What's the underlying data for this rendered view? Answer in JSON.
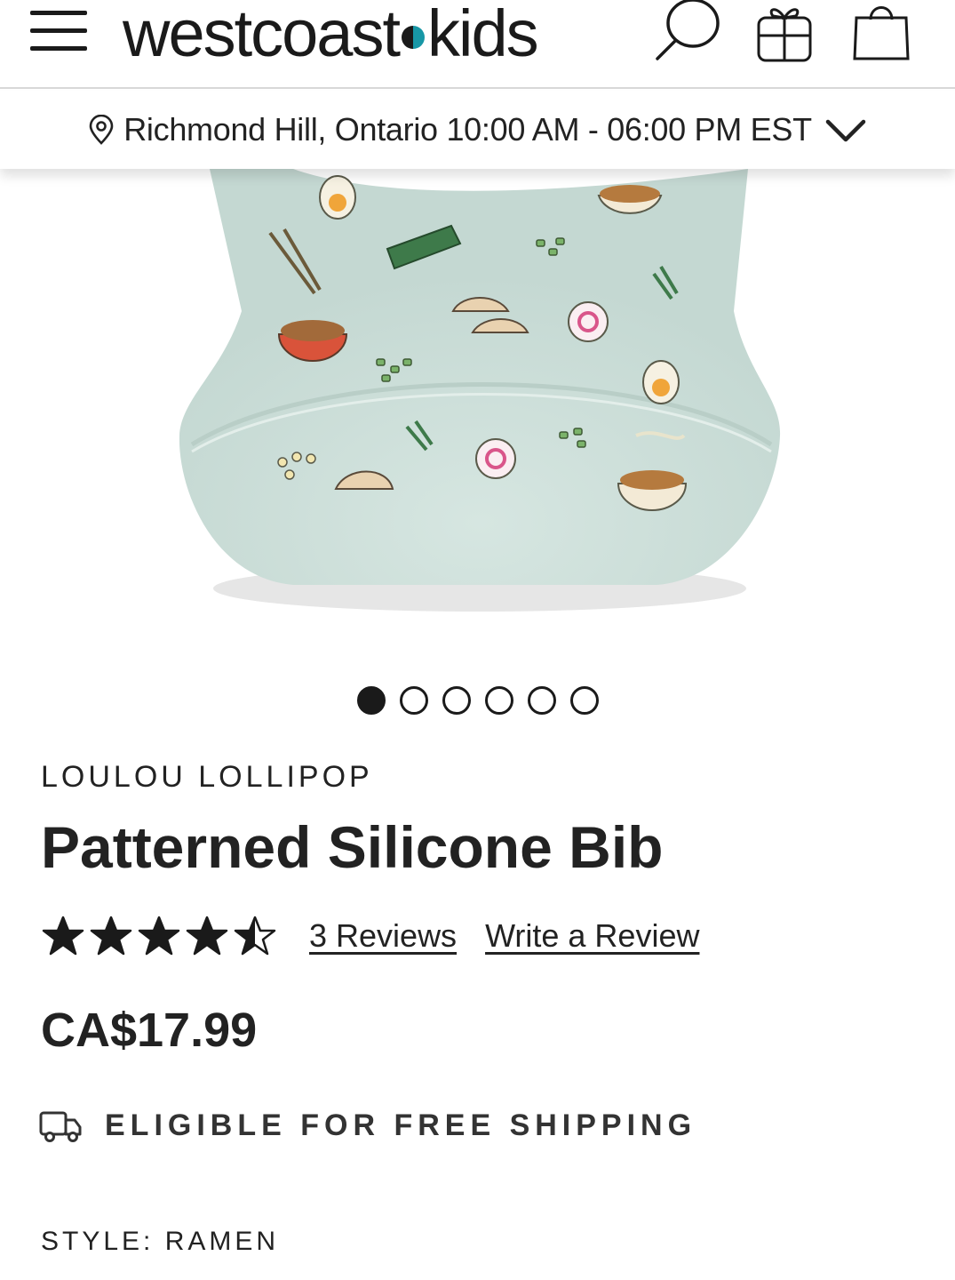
{
  "header": {
    "logo_left": "westcoast",
    "logo_right": "kids",
    "icons": [
      "menu-icon",
      "search-icon",
      "gift-icon",
      "shopping-bag-icon"
    ]
  },
  "location": {
    "text": "Richmond Hill, Ontario 10:00 AM - 06:00 PM EST",
    "icon": "map-pin-icon",
    "toggle_icon": "chevron-down-icon"
  },
  "carousel": {
    "total": 6,
    "active": 1
  },
  "product": {
    "brand": "LOULOU LOLLIPOP",
    "title": "Patterned Silicone Bib",
    "rating": 4.5,
    "rating_max": 5,
    "reviews_link": "3 Reviews",
    "write_review_link": "Write a Review",
    "price": "CA$17.99",
    "shipping": "ELIGIBLE FOR FREE SHIPPING",
    "style_label": "STYLE:",
    "style_value": "RAMEN"
  },
  "colors": {
    "bib": "#cfe0db",
    "accent": "#1797a6",
    "text": "#222222"
  }
}
